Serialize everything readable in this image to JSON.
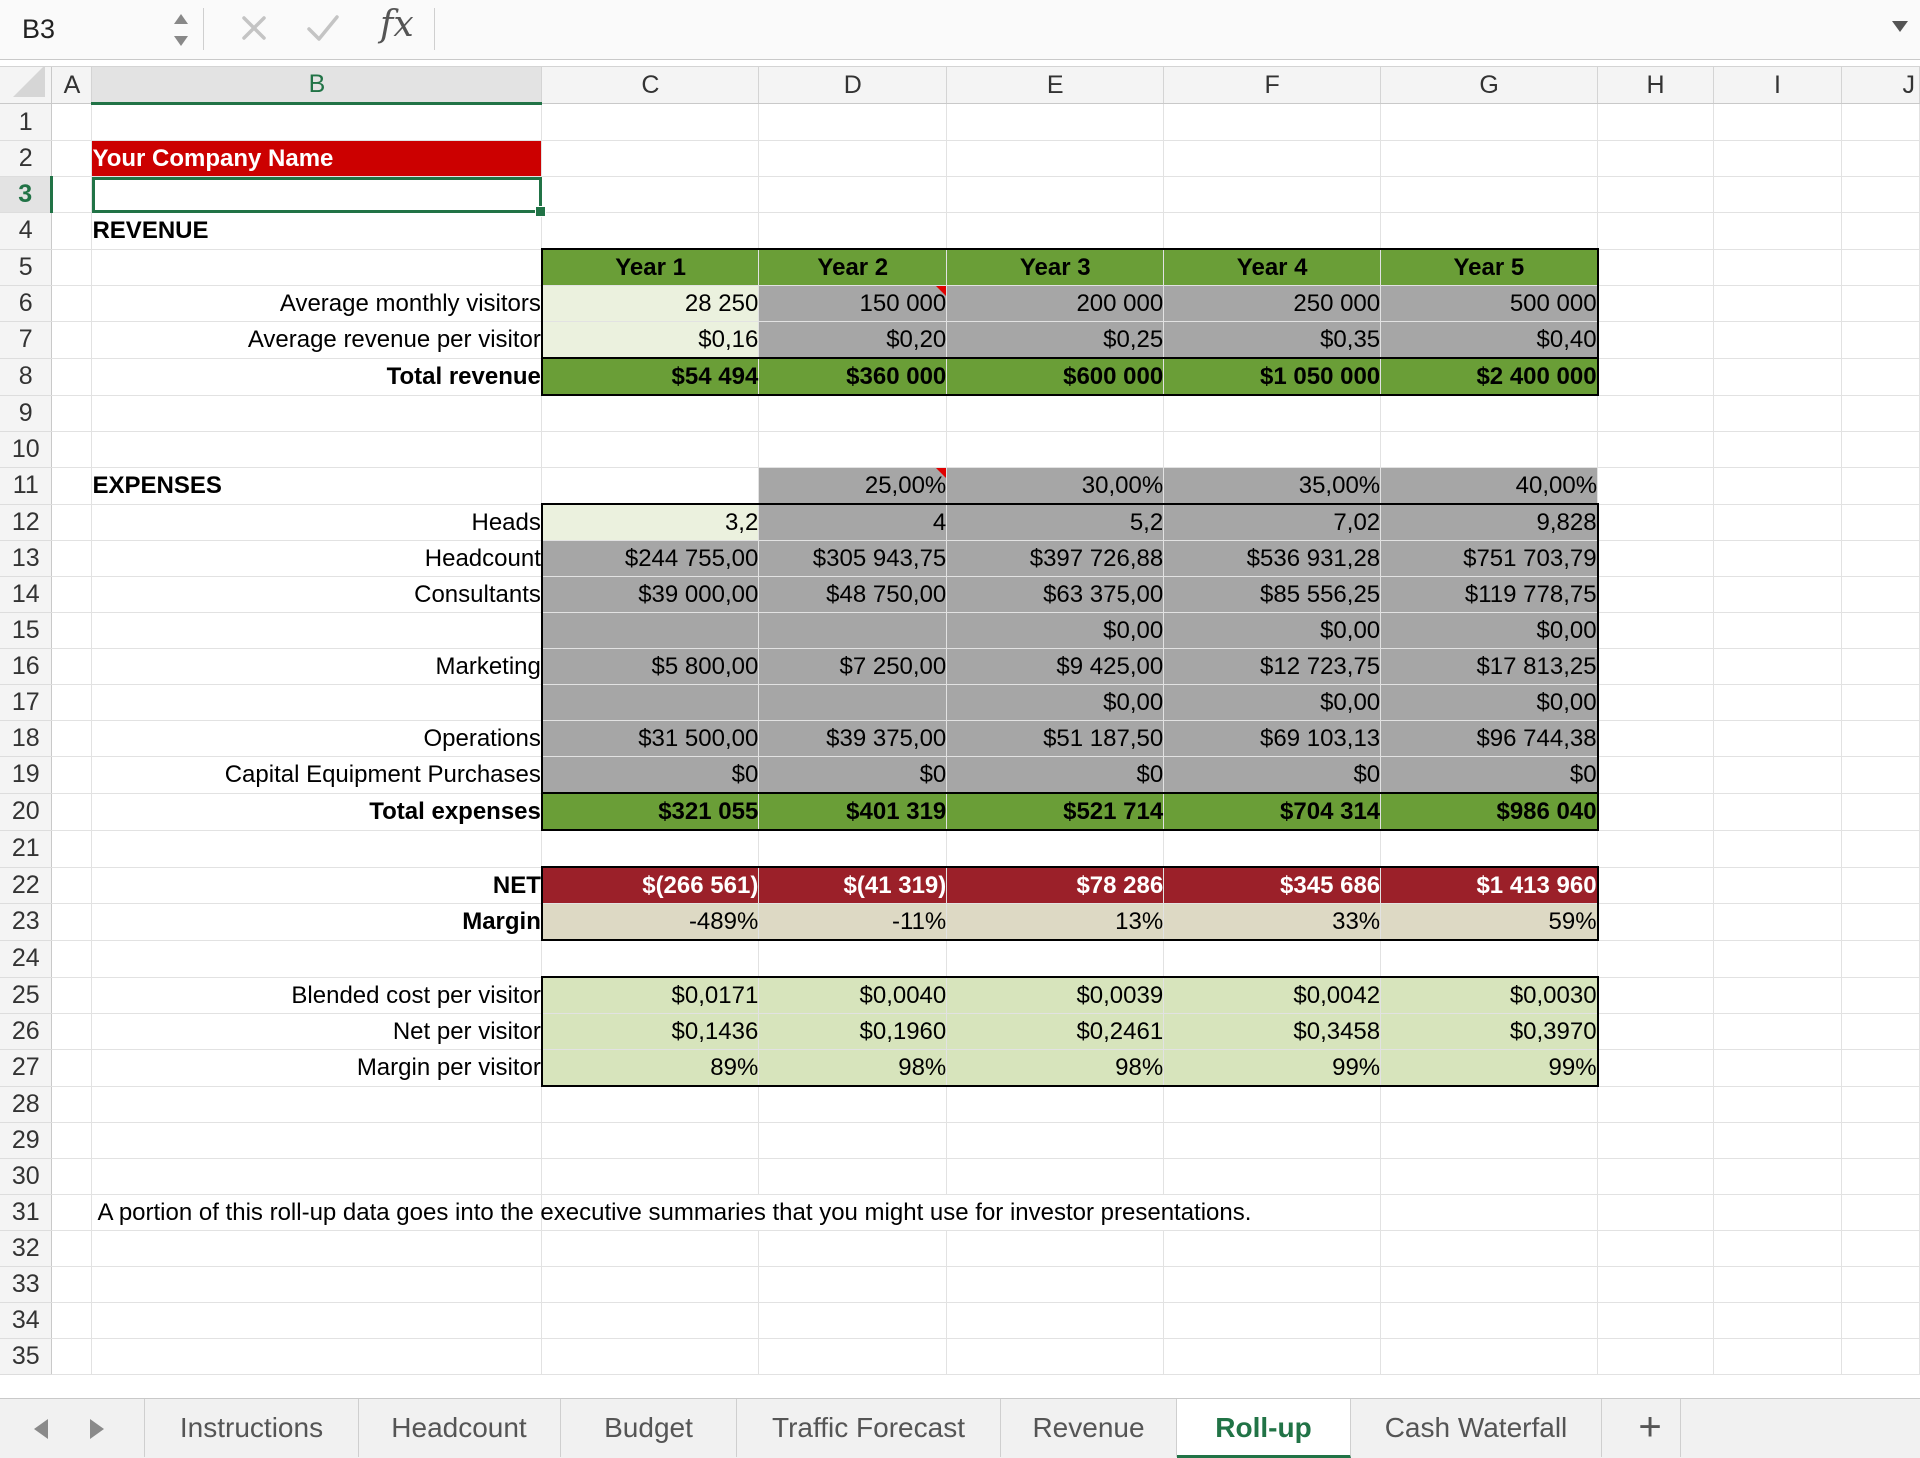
{
  "formula_bar": {
    "name_box": "B3",
    "fx_label": "fx",
    "formula": ""
  },
  "columns": [
    "A",
    "B",
    "C",
    "D",
    "E",
    "F",
    "G",
    "H",
    "I",
    "J"
  ],
  "rows": [
    "1",
    "2",
    "3",
    "4",
    "5",
    "6",
    "7",
    "8",
    "9",
    "10",
    "11",
    "12",
    "13",
    "14",
    "15",
    "16",
    "17",
    "18",
    "19",
    "20",
    "21",
    "22",
    "23",
    "24",
    "25",
    "26",
    "27",
    "28",
    "29",
    "30",
    "31",
    "32",
    "33",
    "34",
    "35"
  ],
  "sheet": {
    "company_name": "Your Company Name",
    "revenue_title": "REVENUE",
    "years": [
      "Year 1",
      "Year 2",
      "Year 3",
      "Year 4",
      "Year 5"
    ],
    "revenue_rows": [
      {
        "label": "Average monthly visitors",
        "values": [
          "28 250",
          "150 000",
          "200 000",
          "250 000",
          "500 000"
        ]
      },
      {
        "label": "Average revenue per visitor",
        "values": [
          "$0,16",
          "$0,20",
          "$0,25",
          "$0,35",
          "$0,40"
        ]
      },
      {
        "label": "Total revenue",
        "values": [
          "$54 494",
          "$360 000",
          "$600 000",
          "$1 050 000",
          "$2 400 000"
        ]
      }
    ],
    "expenses_title": "EXPENSES",
    "growth_rates": [
      "",
      "25,00%",
      "30,00%",
      "35,00%",
      "40,00%"
    ],
    "expense_rows": [
      {
        "label": "Heads",
        "values": [
          "3,2",
          "4",
          "5,2",
          "7,02",
          "9,828"
        ]
      },
      {
        "label": "Headcount",
        "values": [
          "$244 755,00",
          "$305 943,75",
          "$397 726,88",
          "$536 931,28",
          "$751 703,79"
        ]
      },
      {
        "label": "Consultants",
        "values": [
          "$39 000,00",
          "$48 750,00",
          "$63 375,00",
          "$85 556,25",
          "$119 778,75"
        ]
      },
      {
        "label": "",
        "values": [
          "",
          "",
          "$0,00",
          "$0,00",
          "$0,00"
        ]
      },
      {
        "label": "Marketing",
        "values": [
          "$5 800,00",
          "$7 250,00",
          "$9 425,00",
          "$12 723,75",
          "$17 813,25"
        ]
      },
      {
        "label": "",
        "values": [
          "",
          "",
          "$0,00",
          "$0,00",
          "$0,00"
        ]
      },
      {
        "label": "Operations",
        "values": [
          "$31 500,00",
          "$39 375,00",
          "$51 187,50",
          "$69 103,13",
          "$96 744,38"
        ]
      },
      {
        "label": "Capital Equipment Purchases",
        "values": [
          "$0",
          "$0",
          "$0",
          "$0",
          "$0"
        ]
      }
    ],
    "total_expenses": {
      "label": "Total expenses",
      "values": [
        "$321 055",
        "$401 319",
        "$521 714",
        "$704 314",
        "$986 040"
      ]
    },
    "net": {
      "label": "NET",
      "values": [
        "$(266 561)",
        "$(41 319)",
        "$78 286",
        "$345 686",
        "$1 413 960"
      ]
    },
    "margin": {
      "label": "Margin",
      "values": [
        "-489%",
        "-11%",
        "13%",
        "33%",
        "59%"
      ]
    },
    "visitor_rows": [
      {
        "label": "Blended cost per visitor",
        "values": [
          "$0,0171",
          "$0,0040",
          "$0,0039",
          "$0,0042",
          "$0,0030"
        ]
      },
      {
        "label": "Net per visitor",
        "values": [
          "$0,1436",
          "$0,1960",
          "$0,2461",
          "$0,3458",
          "$0,3970"
        ]
      },
      {
        "label": "Margin per visitor",
        "values": [
          "89%",
          "98%",
          "98%",
          "99%",
          "99%"
        ]
      }
    ],
    "note": "A portion of this roll-up data goes into the executive summaries that you might use for investor presentations."
  },
  "tabs": [
    "Instructions",
    "Headcount",
    "Budget",
    "Traffic Forecast",
    "Revenue",
    "Roll-up",
    "Cash Waterfall"
  ],
  "active_tab": "Roll-up",
  "add_sheet_label": "+",
  "colors": {
    "accent": "#217346",
    "header_green": "#6a9e37",
    "input_grey": "#a6a6a6",
    "net_red": "#9b2029",
    "company_red": "#cc0000"
  }
}
